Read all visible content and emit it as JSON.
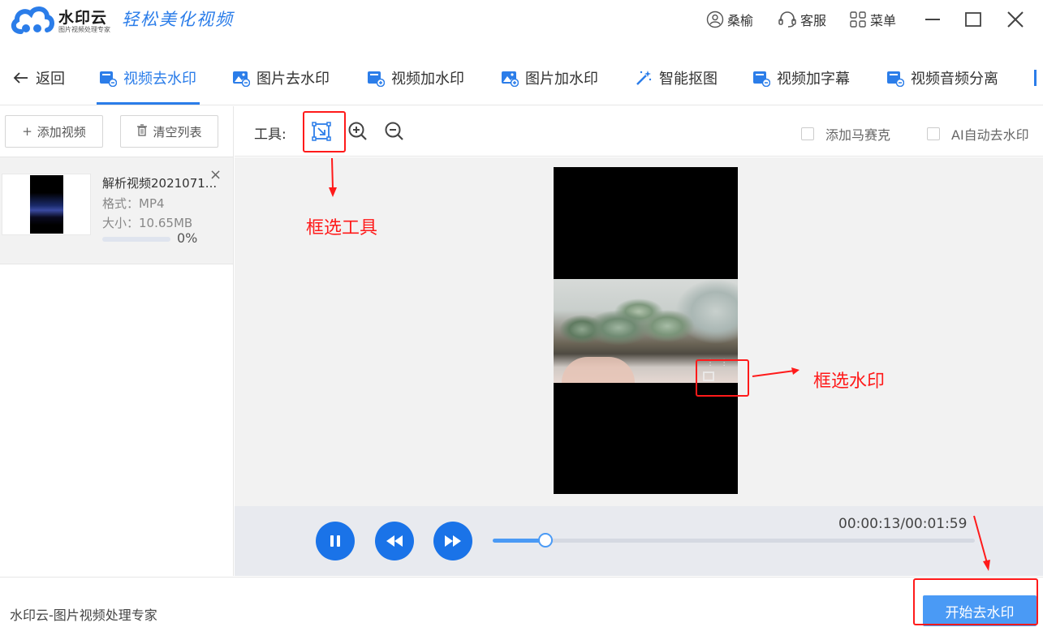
{
  "app": {
    "name": "水印云",
    "subtitle": "图片视频处理专家",
    "slogan": "轻松美化视频"
  },
  "titlebar": {
    "user_label": "桑榆",
    "service_label": "客服",
    "menu_label": "菜单",
    "user_icon": "user-icon",
    "service_icon": "headset-icon",
    "menu_icon": "grid-icon"
  },
  "nav": {
    "back_label": "返回",
    "tabs": [
      {
        "label": "视频去水印",
        "icon": "video-icon",
        "active": true
      },
      {
        "label": "图片去水印",
        "icon": "image-icon",
        "active": false
      },
      {
        "label": "视频加水印",
        "icon": "video-icon",
        "active": false
      },
      {
        "label": "图片加水印",
        "icon": "image-icon",
        "active": false
      },
      {
        "label": "智能抠图",
        "icon": "magic-wand-icon",
        "active": false
      },
      {
        "label": "视频加字幕",
        "icon": "video-icon",
        "active": false
      },
      {
        "label": "视频音频分离",
        "icon": "video-icon",
        "active": false
      }
    ]
  },
  "sidebar": {
    "add_video_label": "添加视频",
    "clear_list_label": "清空列表",
    "files": [
      {
        "name": "解析视频2021071...",
        "format": "格式：MP4",
        "size": "大小：10.65MB",
        "progress_label": "0%",
        "progress": 0
      }
    ]
  },
  "toolbar": {
    "tools_label": "工具:",
    "mosaic_label": "添加马赛克",
    "ai_remove_label": "AI自动去水印"
  },
  "annotations": {
    "select_tool": "框选工具",
    "select_watermark": "框选水印"
  },
  "player": {
    "time": "00:00:13/00:01:59",
    "progress": 0.11
  },
  "status": {
    "text": "水印云-图片视频处理专家",
    "start_button": "开始去水印"
  },
  "colors": {
    "accent": "#2b7de9",
    "annotation": "#ff1a1a",
    "button": "#4a9af5"
  }
}
